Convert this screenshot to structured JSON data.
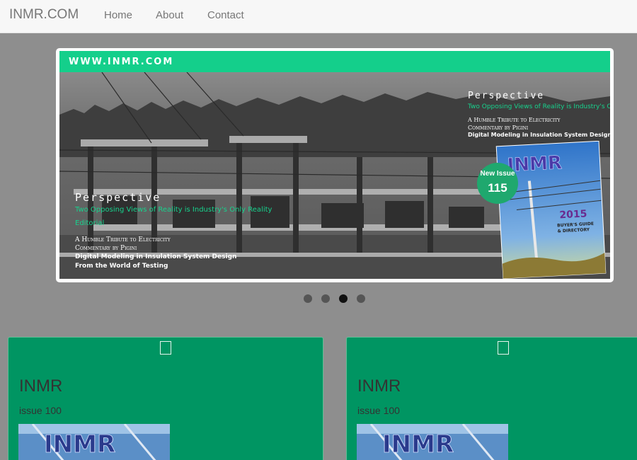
{
  "navbar": {
    "brand": "INMR.COM",
    "links": [
      "Home",
      "About",
      "Contact"
    ]
  },
  "carousel": {
    "header": "WWW.INMR.COM",
    "left": {
      "heading": "Perspective",
      "green1": "Two Opposing Views of Reality is Industry's Only Reality",
      "green2": "Editorial",
      "small1": "A Humble Tribute to Electricity",
      "small2": "Commentary by Pigini",
      "bold1": "Digital Modeling in Insulation System Design",
      "bold2": "From the World of Testing"
    },
    "right": {
      "heading": "Perspective",
      "green1": "Two Opposing Views of Reality is Industry's Only Reality",
      "small1": "A Humble Tribute to Electricity",
      "small2": "Commentary by Pigini",
      "bold1": "Digital Modeling in Insulation System Design"
    },
    "badge": {
      "label": "New Issue",
      "number": "115"
    },
    "cover": {
      "title": "INMR",
      "year": "2015",
      "subtitle1": "BUYER'S GUIDE",
      "subtitle2": "& DIRECTORY"
    },
    "indicators": {
      "count": 4,
      "active_index": 2
    }
  },
  "cards": [
    {
      "title": "INMR",
      "subtitle": "issue 100",
      "image_text": "INMR"
    },
    {
      "title": "INMR",
      "subtitle": "issue 100",
      "image_text": "INMR"
    }
  ],
  "colors": {
    "accent_green": "#14cf8b",
    "card_green": "#009562",
    "badge_green": "#1fa86e",
    "page_bg": "#8e8e8e"
  }
}
